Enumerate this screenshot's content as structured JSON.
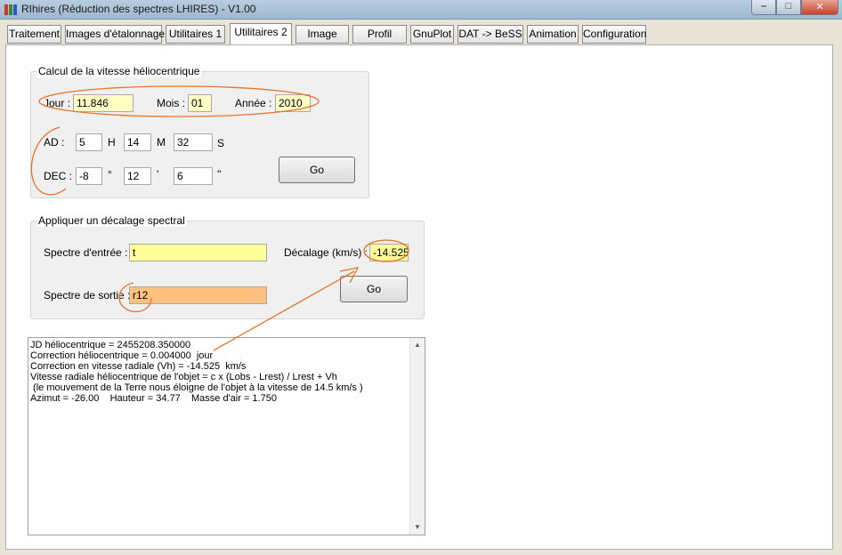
{
  "window": {
    "title": "RIhires (Réduction des spectres LHIRES) - V1.00",
    "controls": {
      "minimize": "–",
      "maximize": "□",
      "close": "✕"
    },
    "icon_colors": [
      "#d9342b",
      "#3a8a3a",
      "#2b59c3"
    ]
  },
  "tabs": [
    {
      "label": "Traitement"
    },
    {
      "label": "Images d'étalonnage"
    },
    {
      "label": "Utilitaires 1"
    },
    {
      "label": "Utilitaires 2",
      "active": true
    },
    {
      "label": "Image"
    },
    {
      "label": "Profil"
    },
    {
      "label": "GnuPlot"
    },
    {
      "label": "DAT -> BeSS"
    },
    {
      "label": "Animation"
    },
    {
      "label": "Configuration"
    }
  ],
  "helio": {
    "title": "Calcul de la vitesse héliocentrique",
    "jour_label": "Jour :",
    "jour_value": "11.846",
    "mois_label": "Mois :",
    "mois_value": "01",
    "annee_label": "Année :",
    "annee_value": "2010",
    "ad_label": "AD :",
    "ad_h_value": "5",
    "ad_h_unit": "H",
    "ad_m_value": "14",
    "ad_m_unit": "M",
    "ad_s_value": "32",
    "ad_s_unit": "S",
    "dec_label": "DEC :",
    "dec_deg_value": "-8",
    "dec_deg_unit": "°",
    "dec_min_value": "12",
    "dec_min_unit": "'",
    "dec_sec_value": "6",
    "dec_sec_unit": "''",
    "go_label": "Go"
  },
  "shift": {
    "title": "Appliquer un décalage spectral",
    "input_label": "Spectre d'entrée :",
    "input_value": "t",
    "output_label": "Spectre de sortie :",
    "output_value": "r12",
    "offset_label": "Décalage (km/s) :",
    "offset_value": "-14.525",
    "go_label": "Go"
  },
  "results": {
    "text": "JD héliocentrique = 2455208.350000\nCorrection héliocentrique = 0.004000  jour\nCorrection en vitesse radiale (Vh) = -14.525  km/s\nVitesse radiale héliocentrique de l'objet = c x (Lobs - Lrest) / Lrest + Vh\n (le mouvement de la Terre nous éloigne de l'objet à la vitesse de 14.5 km/s )\nAzimut = -26.00    Hauteur = 34.77    Masse d'air = 1.750",
    "scroll_up": "▲",
    "scroll_down": "▼"
  },
  "annotation_color": "#e8732a"
}
